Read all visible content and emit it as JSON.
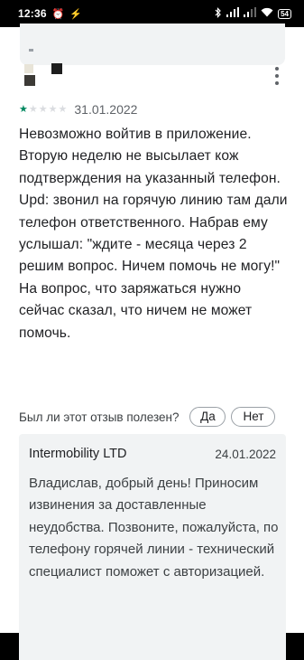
{
  "status_bar": {
    "time": "12:36",
    "left_icons": [
      "alarm-clock-icon",
      "sync-icon"
    ],
    "right_icons": [
      "bluetooth-icon",
      "signal-icon",
      "signal-icon",
      "wifi-icon"
    ],
    "battery": "54"
  },
  "review": {
    "rating": 1,
    "max_rating": 5,
    "date": "31.01.2022",
    "text": "Невозможно войтив в приложение. Вторую неделю не высылает кож подтверждения на указанный телефон. Upd: звонил на горячую линию там дали телефон ответственного. Набрав ему услышал: \"ждите - месяца через 2 решим вопрос. Ничем помочь не могу!\" На вопрос, что заряжаться нужно сейчас сказал, что ничем не может помочь."
  },
  "helpful": {
    "question": "Был ли этот отзыв полезен?",
    "yes_label": "Да",
    "no_label": "Нет"
  },
  "reply": {
    "developer": "Intermobility LTD",
    "date": "24.01.2022",
    "text": "Владислав, добрый день! Приносим извинения за доставленные неудобства. Позвоните, пожалуйста, по телефону горячей линии - технический специалист поможет с авторизацией."
  }
}
